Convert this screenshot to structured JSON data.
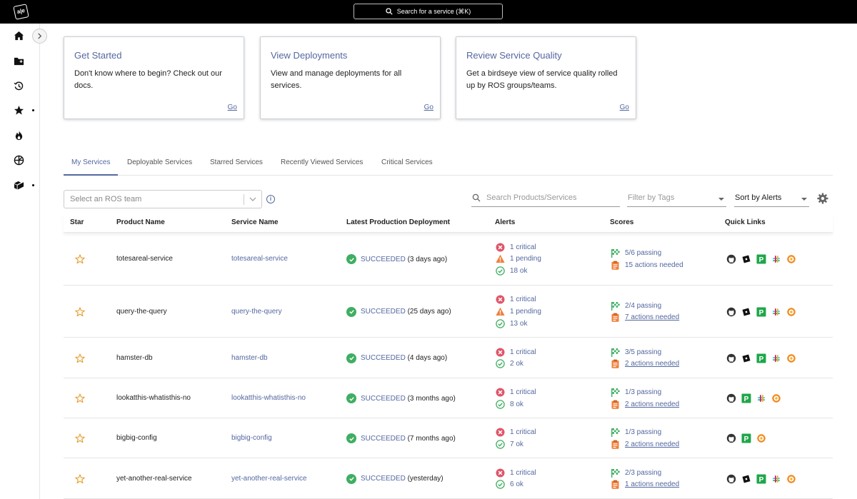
{
  "topbar": {
    "logo_text": "a|e",
    "search_label": "Search for a service (⌘K)"
  },
  "sidebar": {
    "items": [
      {
        "icon": "home-icon",
        "dot": false
      },
      {
        "icon": "folder-add-icon",
        "dot": false
      },
      {
        "icon": "history-icon",
        "dot": false
      },
      {
        "icon": "star-icon",
        "dot": true
      },
      {
        "icon": "fire-icon",
        "dot": false
      },
      {
        "icon": "globe-icon",
        "dot": false
      },
      {
        "icon": "cube-icon",
        "dot": true
      }
    ]
  },
  "cards": [
    {
      "title": "Get Started",
      "body": "Don't know where to begin? Check out our docs.",
      "link": "Go"
    },
    {
      "title": "View Deployments",
      "body": "View and manage deployments for all services.",
      "link": "Go"
    },
    {
      "title": "Review Service Quality",
      "body": "Get a birdseye view of service quality rolled up by ROS groups/teams.",
      "link": "Go"
    }
  ],
  "tabs": [
    "My Services",
    "Deployable Services",
    "Starred Services",
    "Recently Viewed Services",
    "Critical Services"
  ],
  "active_tab": "My Services",
  "filters": {
    "ros_placeholder": "Select an ROS team",
    "search_placeholder": "Search Products/Services",
    "tags_placeholder": "Filter by Tags",
    "sort_label": "Sort by Alerts"
  },
  "columns": [
    "Star",
    "Product Name",
    "Service Name",
    "Latest Production Deployment",
    "Alerts",
    "Scores",
    "Quick Links"
  ],
  "rows": [
    {
      "product": "totesareal-service",
      "service": "totesareal-service",
      "status": "SUCCEEDED",
      "when": "(3 days ago)",
      "alerts": [
        {
          "kind": "critical",
          "text": "1 critical"
        },
        {
          "kind": "pending",
          "text": "1 pending"
        },
        {
          "kind": "ok",
          "text": "18 ok"
        }
      ],
      "passing": "5/6 passing",
      "actions": "15 actions needed",
      "actions_underline": false,
      "links": [
        "github",
        "roblox",
        "pagerduty",
        "slack",
        "grafana"
      ]
    },
    {
      "product": "query-the-query",
      "service": "query-the-query",
      "status": "SUCCEEDED",
      "when": "(25 days ago)",
      "alerts": [
        {
          "kind": "critical",
          "text": "1 critical"
        },
        {
          "kind": "pending",
          "text": "1 pending"
        },
        {
          "kind": "ok",
          "text": "13 ok"
        }
      ],
      "passing": "2/4 passing",
      "actions": "7 actions needed",
      "actions_underline": true,
      "links": [
        "github",
        "roblox",
        "pagerduty",
        "slack",
        "grafana"
      ]
    },
    {
      "product": "hamster-db",
      "service": "hamster-db",
      "status": "SUCCEEDED",
      "when": "(4 days ago)",
      "alerts": [
        {
          "kind": "critical",
          "text": "1 critical"
        },
        {
          "kind": "ok",
          "text": "2 ok"
        }
      ],
      "passing": "3/5 passing",
      "actions": "2 actions needed",
      "actions_underline": true,
      "links": [
        "github",
        "roblox",
        "pagerduty",
        "slack",
        "grafana"
      ]
    },
    {
      "product": "lookatthis-whatisthis-no",
      "service": "lookatthis-whatisthis-no",
      "status": "SUCCEEDED",
      "when": "(3 months ago)",
      "alerts": [
        {
          "kind": "critical",
          "text": "1 critical"
        },
        {
          "kind": "ok",
          "text": "8 ok"
        }
      ],
      "passing": "1/3 passing",
      "actions": "2 actions needed",
      "actions_underline": true,
      "links": [
        "github",
        "pagerduty",
        "slack",
        "grafana"
      ]
    },
    {
      "product": "bigbig-config",
      "service": "bigbig-config",
      "status": "SUCCEEDED",
      "when": "(7 months ago)",
      "alerts": [
        {
          "kind": "critical",
          "text": "1 critical"
        },
        {
          "kind": "ok",
          "text": "7 ok"
        }
      ],
      "passing": "1/3 passing",
      "actions": "2 actions needed",
      "actions_underline": true,
      "links": [
        "github",
        "pagerduty",
        "grafana"
      ]
    },
    {
      "product": "yet-another-real-service",
      "service": "yet-another-real-service",
      "status": "SUCCEEDED",
      "when": "(yesterday)",
      "alerts": [
        {
          "kind": "critical",
          "text": "1 critical"
        },
        {
          "kind": "ok",
          "text": "6 ok"
        }
      ],
      "passing": "2/3 passing",
      "actions": "1 actions needed",
      "actions_underline": true,
      "links": [
        "github",
        "roblox",
        "pagerduty",
        "slack",
        "grafana"
      ]
    }
  ],
  "colors": {
    "accent": "#5468a0",
    "success": "#3fae62",
    "critical": "#e0556a",
    "pending": "#ef7f3a",
    "star": "#e8a23a"
  }
}
